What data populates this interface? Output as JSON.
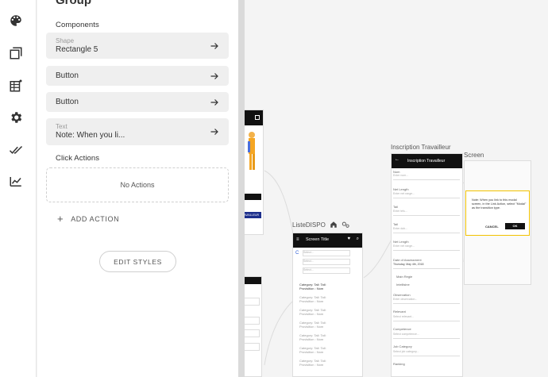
{
  "panel": {
    "title": "Group",
    "components_label": "Components",
    "components": [
      {
        "sub": "Shape",
        "label": "Rectangle 5"
      },
      {
        "sub": "",
        "label": "Button"
      },
      {
        "sub": "",
        "label": "Button"
      },
      {
        "sub": "Text",
        "label": "Note: When you li..."
      }
    ],
    "click_actions_label": "Click Actions",
    "no_actions": "No Actions",
    "add_action": "ADD ACTION",
    "edit_styles": "EDIT STYLES"
  },
  "rail": {
    "icons": [
      "palette-icon",
      "layers-icon",
      "data-table-icon",
      "settings-icon",
      "checks-icon",
      "analytics-icon"
    ]
  },
  "canvas": {
    "frame_liste": {
      "label": "ListeDISPO",
      "header_title": "Screen Title"
    },
    "frame_inscription": {
      "label": "Inscription Travailleur",
      "header_title": "Inscription Travailleur"
    },
    "frame_screen": {
      "label": "Screen"
    },
    "modal": {
      "text": "Note: When you link to this modal screen, in the Link Action, select \"Modal\" as the transition type.",
      "cancel": "CANCEL",
      "ok": "OK"
    },
    "liste_rows": [
      {
        "line1": "Category: Tail: Tail:",
        "line2": "Provisition : Nom"
      },
      {
        "line1": "Category: Tail: Tail:",
        "line2": "Provisition : Nom"
      },
      {
        "line1": "Category: Tail: Tail:",
        "line2": "Provisition : Nom"
      },
      {
        "line1": "Category: Tail: Tail:",
        "line2": "Provisition : Nom"
      },
      {
        "line1": "Category: Tail: Tail:",
        "line2": "Provisition : Nom"
      },
      {
        "line1": "Category: Tail: Tail:",
        "line2": "Provisition : Nom"
      },
      {
        "line1": "Category: Tail: Tail:",
        "line2": "Provisition : Nom"
      }
    ],
    "liste_selects": [
      "Select...",
      "Select...",
      "Select..."
    ],
    "inscription_fields": [
      {
        "label": "Nom",
        "placeholder": "Enter nom..."
      },
      {
        "label": "Net Length",
        "placeholder": "Enter net range..."
      },
      {
        "label": "Tail",
        "placeholder": "Enter tels..."
      },
      {
        "label": "Tail",
        "placeholder": "Enter dob..."
      },
      {
        "label": "Net Length",
        "placeholder": "Enter net range..."
      },
      {
        "label": "Date of Assessment",
        "placeholder": "Thursday, May 4th, 2018"
      },
      {
        "label": "Observation",
        "placeholder": "Enter observation..."
      },
      {
        "label": "Relevant",
        "placeholder": "Select relevant..."
      },
      {
        "label": "Competence",
        "placeholder": "Select competence..."
      },
      {
        "label": "Job Category",
        "placeholder": "Select job category..."
      },
      {
        "label": "Ranking",
        "placeholder": ""
      }
    ],
    "inscription_radios": [
      "Main Regie",
      "Intellisine"
    ],
    "left_frame_button": "TRAVAILLEUR"
  }
}
